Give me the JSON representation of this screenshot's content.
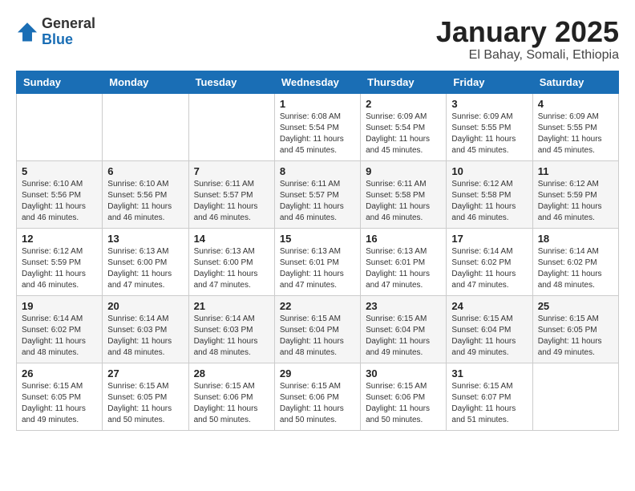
{
  "header": {
    "logo_general": "General",
    "logo_blue": "Blue",
    "month_title": "January 2025",
    "location": "El Bahay, Somali, Ethiopia"
  },
  "weekdays": [
    "Sunday",
    "Monday",
    "Tuesday",
    "Wednesday",
    "Thursday",
    "Friday",
    "Saturday"
  ],
  "weeks": [
    [
      {
        "day": "",
        "info": ""
      },
      {
        "day": "",
        "info": ""
      },
      {
        "day": "",
        "info": ""
      },
      {
        "day": "1",
        "info": "Sunrise: 6:08 AM\nSunset: 5:54 PM\nDaylight: 11 hours\nand 45 minutes."
      },
      {
        "day": "2",
        "info": "Sunrise: 6:09 AM\nSunset: 5:54 PM\nDaylight: 11 hours\nand 45 minutes."
      },
      {
        "day": "3",
        "info": "Sunrise: 6:09 AM\nSunset: 5:55 PM\nDaylight: 11 hours\nand 45 minutes."
      },
      {
        "day": "4",
        "info": "Sunrise: 6:09 AM\nSunset: 5:55 PM\nDaylight: 11 hours\nand 45 minutes."
      }
    ],
    [
      {
        "day": "5",
        "info": "Sunrise: 6:10 AM\nSunset: 5:56 PM\nDaylight: 11 hours\nand 46 minutes."
      },
      {
        "day": "6",
        "info": "Sunrise: 6:10 AM\nSunset: 5:56 PM\nDaylight: 11 hours\nand 46 minutes."
      },
      {
        "day": "7",
        "info": "Sunrise: 6:11 AM\nSunset: 5:57 PM\nDaylight: 11 hours\nand 46 minutes."
      },
      {
        "day": "8",
        "info": "Sunrise: 6:11 AM\nSunset: 5:57 PM\nDaylight: 11 hours\nand 46 minutes."
      },
      {
        "day": "9",
        "info": "Sunrise: 6:11 AM\nSunset: 5:58 PM\nDaylight: 11 hours\nand 46 minutes."
      },
      {
        "day": "10",
        "info": "Sunrise: 6:12 AM\nSunset: 5:58 PM\nDaylight: 11 hours\nand 46 minutes."
      },
      {
        "day": "11",
        "info": "Sunrise: 6:12 AM\nSunset: 5:59 PM\nDaylight: 11 hours\nand 46 minutes."
      }
    ],
    [
      {
        "day": "12",
        "info": "Sunrise: 6:12 AM\nSunset: 5:59 PM\nDaylight: 11 hours\nand 46 minutes."
      },
      {
        "day": "13",
        "info": "Sunrise: 6:13 AM\nSunset: 6:00 PM\nDaylight: 11 hours\nand 47 minutes."
      },
      {
        "day": "14",
        "info": "Sunrise: 6:13 AM\nSunset: 6:00 PM\nDaylight: 11 hours\nand 47 minutes."
      },
      {
        "day": "15",
        "info": "Sunrise: 6:13 AM\nSunset: 6:01 PM\nDaylight: 11 hours\nand 47 minutes."
      },
      {
        "day": "16",
        "info": "Sunrise: 6:13 AM\nSunset: 6:01 PM\nDaylight: 11 hours\nand 47 minutes."
      },
      {
        "day": "17",
        "info": "Sunrise: 6:14 AM\nSunset: 6:02 PM\nDaylight: 11 hours\nand 47 minutes."
      },
      {
        "day": "18",
        "info": "Sunrise: 6:14 AM\nSunset: 6:02 PM\nDaylight: 11 hours\nand 48 minutes."
      }
    ],
    [
      {
        "day": "19",
        "info": "Sunrise: 6:14 AM\nSunset: 6:02 PM\nDaylight: 11 hours\nand 48 minutes."
      },
      {
        "day": "20",
        "info": "Sunrise: 6:14 AM\nSunset: 6:03 PM\nDaylight: 11 hours\nand 48 minutes."
      },
      {
        "day": "21",
        "info": "Sunrise: 6:14 AM\nSunset: 6:03 PM\nDaylight: 11 hours\nand 48 minutes."
      },
      {
        "day": "22",
        "info": "Sunrise: 6:15 AM\nSunset: 6:04 PM\nDaylight: 11 hours\nand 48 minutes."
      },
      {
        "day": "23",
        "info": "Sunrise: 6:15 AM\nSunset: 6:04 PM\nDaylight: 11 hours\nand 49 minutes."
      },
      {
        "day": "24",
        "info": "Sunrise: 6:15 AM\nSunset: 6:04 PM\nDaylight: 11 hours\nand 49 minutes."
      },
      {
        "day": "25",
        "info": "Sunrise: 6:15 AM\nSunset: 6:05 PM\nDaylight: 11 hours\nand 49 minutes."
      }
    ],
    [
      {
        "day": "26",
        "info": "Sunrise: 6:15 AM\nSunset: 6:05 PM\nDaylight: 11 hours\nand 49 minutes."
      },
      {
        "day": "27",
        "info": "Sunrise: 6:15 AM\nSunset: 6:05 PM\nDaylight: 11 hours\nand 50 minutes."
      },
      {
        "day": "28",
        "info": "Sunrise: 6:15 AM\nSunset: 6:06 PM\nDaylight: 11 hours\nand 50 minutes."
      },
      {
        "day": "29",
        "info": "Sunrise: 6:15 AM\nSunset: 6:06 PM\nDaylight: 11 hours\nand 50 minutes."
      },
      {
        "day": "30",
        "info": "Sunrise: 6:15 AM\nSunset: 6:06 PM\nDaylight: 11 hours\nand 50 minutes."
      },
      {
        "day": "31",
        "info": "Sunrise: 6:15 AM\nSunset: 6:07 PM\nDaylight: 11 hours\nand 51 minutes."
      },
      {
        "day": "",
        "info": ""
      }
    ]
  ]
}
